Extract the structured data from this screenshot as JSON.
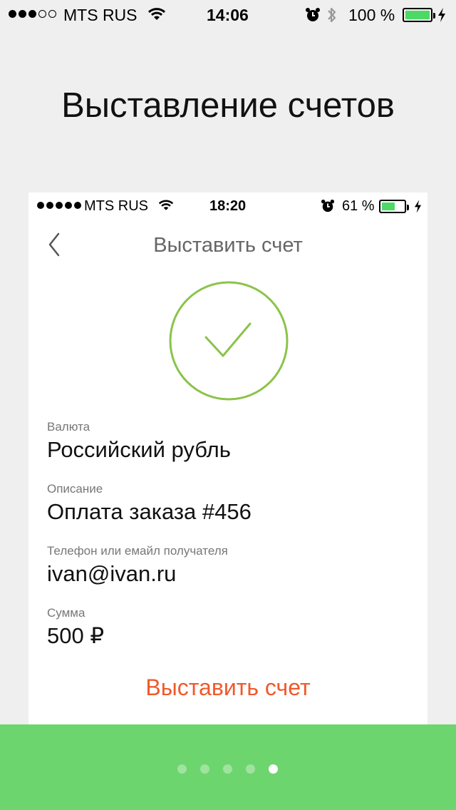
{
  "status_bar": {
    "carrier": "MTS RUS",
    "time": "14:06",
    "battery_text": "100 %",
    "battery_level": 1.0,
    "signal_filled": 3,
    "signal_total": 5
  },
  "headline": "Выставление счетов",
  "mockup": {
    "status_bar": {
      "carrier": "MTS RUS",
      "time": "18:20",
      "battery_text": "61 %",
      "battery_level": 0.61,
      "signal_filled": 5,
      "signal_total": 5
    },
    "nav": {
      "title": "Выставить счет",
      "back_icon": "chevron-left-icon"
    },
    "success_icon": "check-circle-icon",
    "fields": [
      {
        "label": "Валюта",
        "value": "Российский рубль"
      },
      {
        "label": "Описание",
        "value": "Оплата заказа #456"
      },
      {
        "label": "Телефон или емайл получателя",
        "value": "ivan@ivan.ru"
      },
      {
        "label": "Сумма",
        "value": "500 ₽"
      }
    ],
    "action_label": "Выставить счет"
  },
  "pager": {
    "count": 5,
    "active_index": 4
  },
  "colors": {
    "background": "#efefef",
    "accent_green": "#6dd56d",
    "check_green": "#8bc34a",
    "action_orange": "#f0592b",
    "battery_green": "#4cd964"
  }
}
